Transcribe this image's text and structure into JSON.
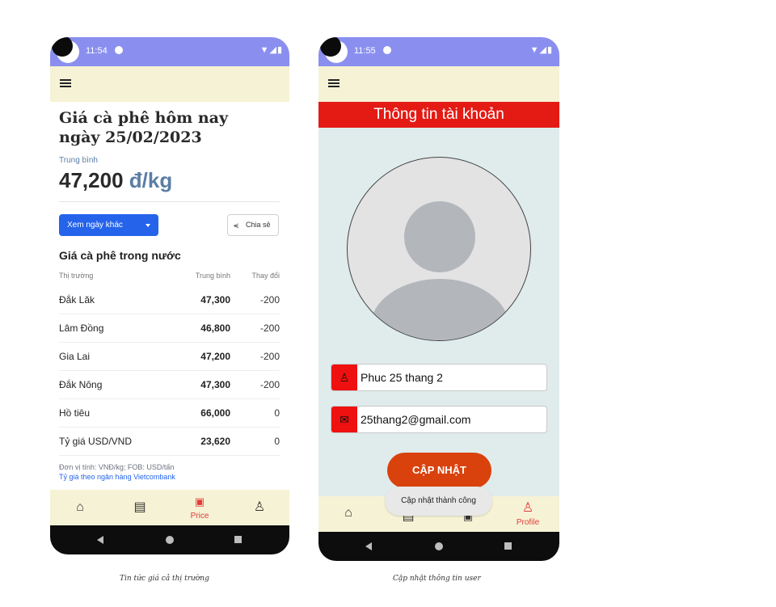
{
  "phone1": {
    "status_time": "11:54",
    "status_right": "▼◢▮",
    "title": "Giá cà phê hôm nay ngày 25/02/2023",
    "avg_label": "Trung bình",
    "avg_value": "47,200",
    "avg_unit": "đ/kg",
    "btn_other_day": "Xem ngày khác",
    "btn_share": "Chia sẻ",
    "section_title": "Giá cà phê trong nước",
    "table_headers": [
      "Thị trường",
      "Trung bình",
      "Thay đổi"
    ],
    "rows": [
      {
        "market": "Đắk Lăk",
        "avg": "47,300",
        "change": "-200"
      },
      {
        "market": "Lâm Đồng",
        "avg": "46,800",
        "change": "-200"
      },
      {
        "market": "Gia Lai",
        "avg": "47,200",
        "change": "-200"
      },
      {
        "market": "Đắk Nông",
        "avg": "47,300",
        "change": "-200"
      },
      {
        "market": "Hồ tiêu",
        "avg": "66,000",
        "change": "0"
      },
      {
        "market": "Tỷ giá USD/VND",
        "avg": "23,620",
        "change": "0"
      }
    ],
    "note_unit": "Đơn vị tính: VNĐ/kg; FOB: USD/tấn",
    "note_bank": "Tỷ giá theo ngân hàng Vietcombank",
    "nav_price_label": "Price"
  },
  "phone2": {
    "status_time": "11:55",
    "status_right": "▼◢▮",
    "header_title": "Thông tin tài khoản",
    "name_value": "Phuc 25 thang 2",
    "email_value": "25thang2@gmail.com",
    "btn_update": "CẬP NHẬT",
    "toast": "Cập nhật thành công",
    "nav_profile_label": "Profile"
  },
  "captions": {
    "left": "Tin tức giá cả thị trường",
    "right": "Cập nhật thông tin user"
  },
  "colors": {
    "statusbar": "#8a8fef",
    "appbar": "#f6f2d5",
    "primary_blue": "#2563eb",
    "header_red": "#e31b14",
    "update_orange": "#d9420d",
    "nav_active": "#e23b3b"
  },
  "icons": {
    "menu": "hamburger-icon",
    "home": "home-icon",
    "news": "news-icon",
    "price": "price-icon",
    "profile": "user-icon",
    "share": "share-icon",
    "person": "person-icon",
    "mail": "mail-icon"
  }
}
